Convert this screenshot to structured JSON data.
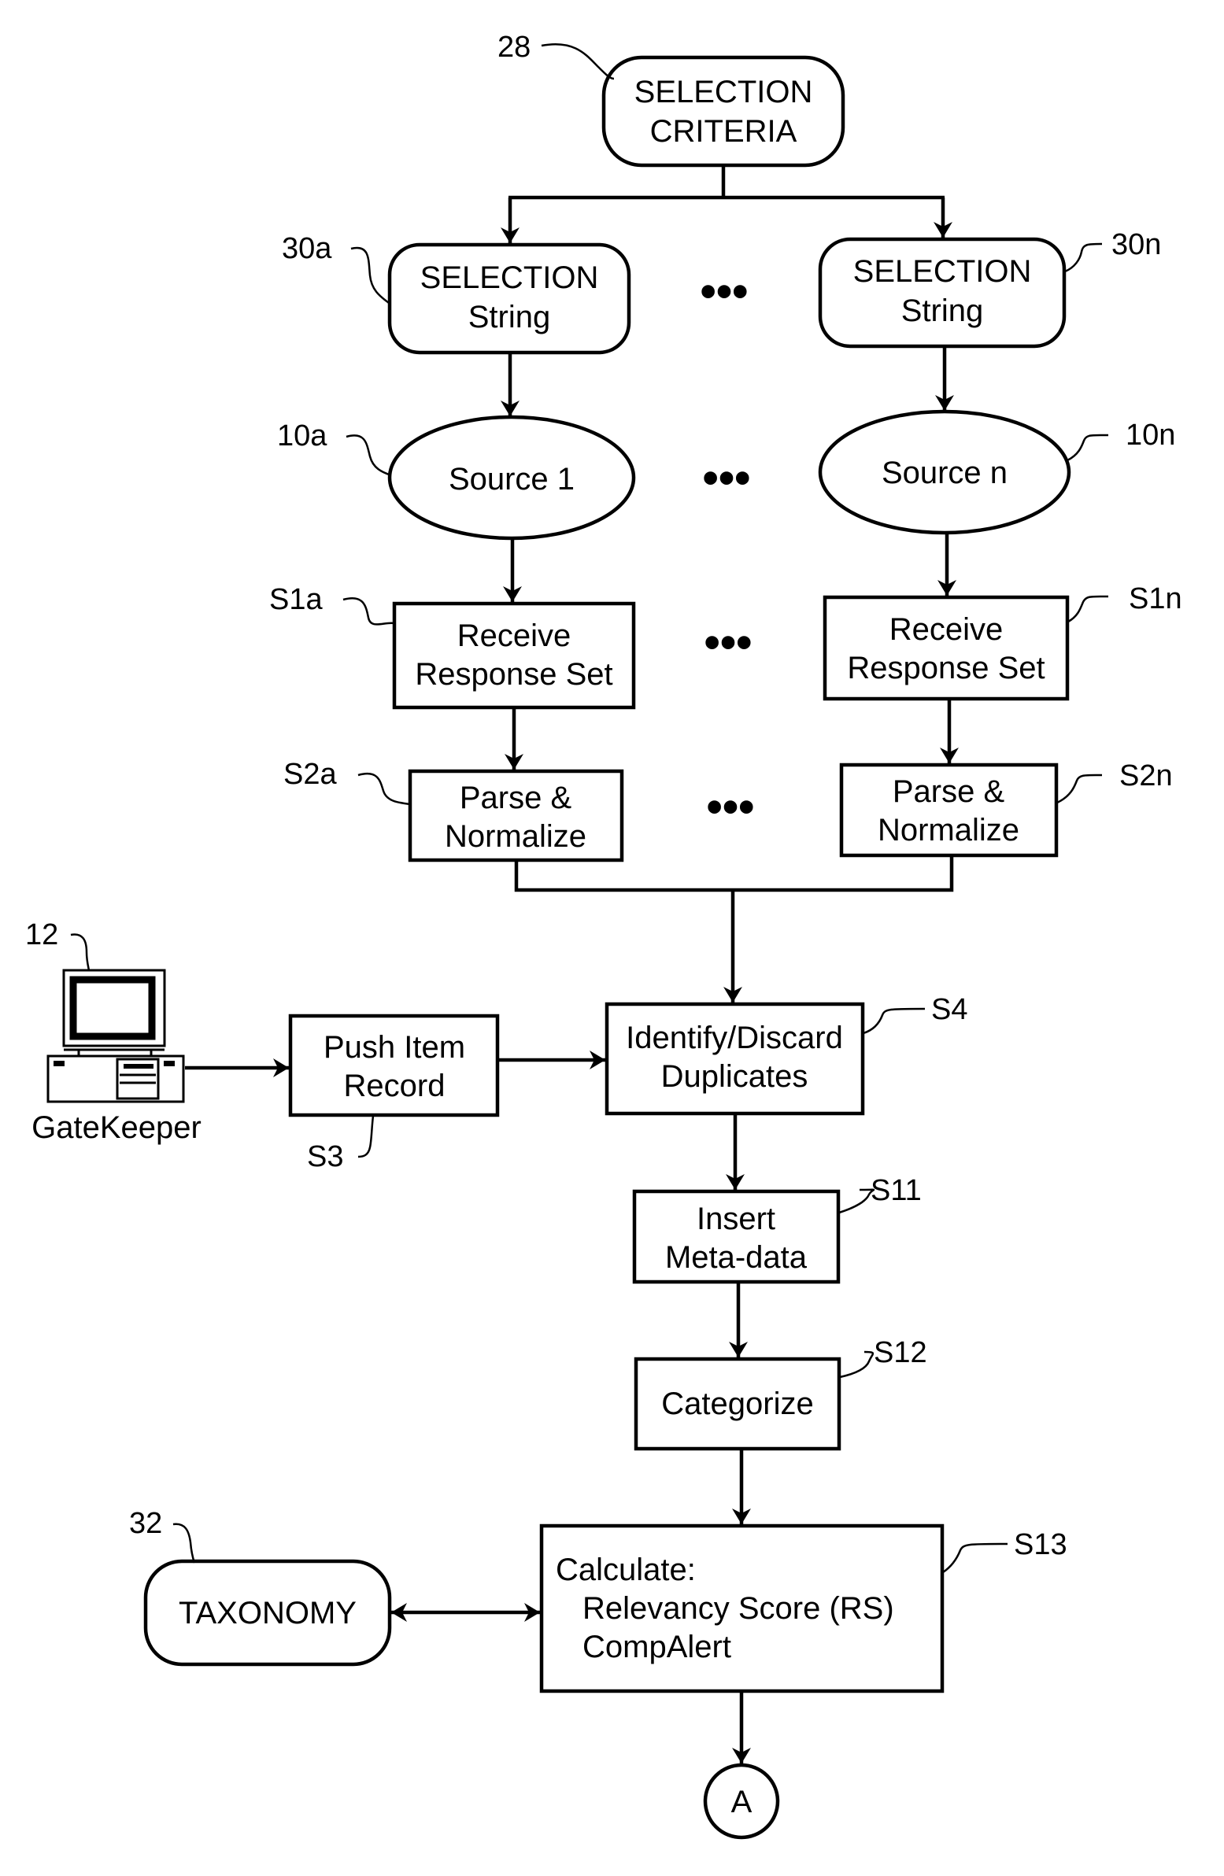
{
  "diagram": {
    "type": "flowchart",
    "colors": {
      "stroke": "#000000",
      "background": "#ffffff"
    },
    "nodes": {
      "selection_criteria": {
        "ref": "28",
        "lines": [
          "SELECTION",
          "CRITERIA"
        ],
        "shape": "rounded-rect"
      },
      "selection_string_a": {
        "ref": "30a",
        "lines": [
          "SELECTION",
          "String"
        ],
        "shape": "rounded-rect"
      },
      "selection_string_n": {
        "ref": "30n",
        "lines": [
          "SELECTION",
          "String"
        ],
        "shape": "rounded-rect"
      },
      "source_1": {
        "ref": "10a",
        "lines": [
          "Source 1"
        ],
        "shape": "ellipse"
      },
      "source_n": {
        "ref": "10n",
        "lines": [
          "Source n"
        ],
        "shape": "ellipse"
      },
      "receive_a": {
        "ref": "S1a",
        "lines": [
          "Receive",
          "Response Set"
        ],
        "shape": "rect"
      },
      "receive_n": {
        "ref": "S1n",
        "lines": [
          "Receive",
          "Response Set"
        ],
        "shape": "rect"
      },
      "parse_a": {
        "ref": "S2a",
        "lines": [
          "Parse &",
          "Normalize"
        ],
        "shape": "rect"
      },
      "parse_n": {
        "ref": "S2n",
        "lines": [
          "Parse &",
          "Normalize"
        ],
        "shape": "rect"
      },
      "gatekeeper": {
        "ref": "12",
        "label": "GateKeeper",
        "shape": "computer-icon"
      },
      "push_item": {
        "ref": "S3",
        "lines": [
          "Push Item",
          "Record"
        ],
        "shape": "rect"
      },
      "identify": {
        "ref": "S4",
        "lines": [
          "Identify/Discard",
          "Duplicates"
        ],
        "shape": "rect"
      },
      "insert_meta": {
        "ref": "S11",
        "lines": [
          "Insert",
          "Meta-data"
        ],
        "shape": "rect"
      },
      "categorize": {
        "ref": "S12",
        "lines": [
          "Categorize"
        ],
        "shape": "rect"
      },
      "calculate": {
        "ref": "S13",
        "lines": [
          "Calculate:",
          "Relevancy Score (RS)",
          "CompAlert"
        ],
        "shape": "rect"
      },
      "taxonomy": {
        "ref": "32",
        "lines": [
          "TAXONOMY"
        ],
        "shape": "rounded-rect"
      },
      "connector_a": {
        "lines": [
          "A"
        ],
        "shape": "circle"
      }
    },
    "ellipsis": "•••",
    "edges": [
      {
        "from": "selection_criteria",
        "to": "selection_string_a"
      },
      {
        "from": "selection_criteria",
        "to": "selection_string_n"
      },
      {
        "from": "selection_string_a",
        "to": "source_1"
      },
      {
        "from": "selection_string_n",
        "to": "source_n"
      },
      {
        "from": "source_1",
        "to": "receive_a"
      },
      {
        "from": "source_n",
        "to": "receive_n"
      },
      {
        "from": "receive_a",
        "to": "parse_a"
      },
      {
        "from": "receive_n",
        "to": "parse_n"
      },
      {
        "from": "parse_a",
        "to": "identify"
      },
      {
        "from": "parse_n",
        "to": "identify"
      },
      {
        "from": "gatekeeper",
        "to": "push_item"
      },
      {
        "from": "push_item",
        "to": "identify"
      },
      {
        "from": "identify",
        "to": "insert_meta"
      },
      {
        "from": "insert_meta",
        "to": "categorize"
      },
      {
        "from": "categorize",
        "to": "calculate"
      },
      {
        "from": "taxonomy",
        "to": "calculate",
        "bidirectional": true
      },
      {
        "from": "calculate",
        "to": "connector_a"
      }
    ]
  }
}
